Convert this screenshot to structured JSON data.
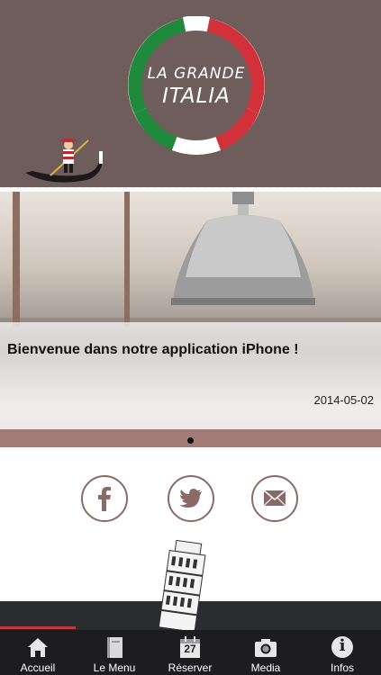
{
  "header": {
    "logo_line1": "LA GRANDE",
    "logo_line2": "ITALIA"
  },
  "banner": {
    "title": "Bienvenue dans notre application iPhone !",
    "date": "2014-05-02",
    "active_slide": 1,
    "slide_count": 1
  },
  "social": [
    {
      "icon": "facebook-icon"
    },
    {
      "icon": "twitter-icon"
    },
    {
      "icon": "mail-icon"
    }
  ],
  "tabbar": {
    "items": [
      {
        "label": "Accueil",
        "icon": "home-icon"
      },
      {
        "label": "Le Menu",
        "icon": "book-icon"
      },
      {
        "label": "Réserver",
        "icon": "calendar-icon",
        "icon_text": "27"
      },
      {
        "label": "Media",
        "icon": "camera-icon"
      },
      {
        "label": "Infos",
        "icon": "info-icon",
        "icon_text": "i"
      }
    ]
  },
  "colors": {
    "header_bg": "#6f5d5b",
    "accent_green": "#1f8a3b",
    "accent_red": "#d3313a",
    "social_ring": "#8a6a67",
    "tabbar_bg": "#1d1d1f"
  }
}
